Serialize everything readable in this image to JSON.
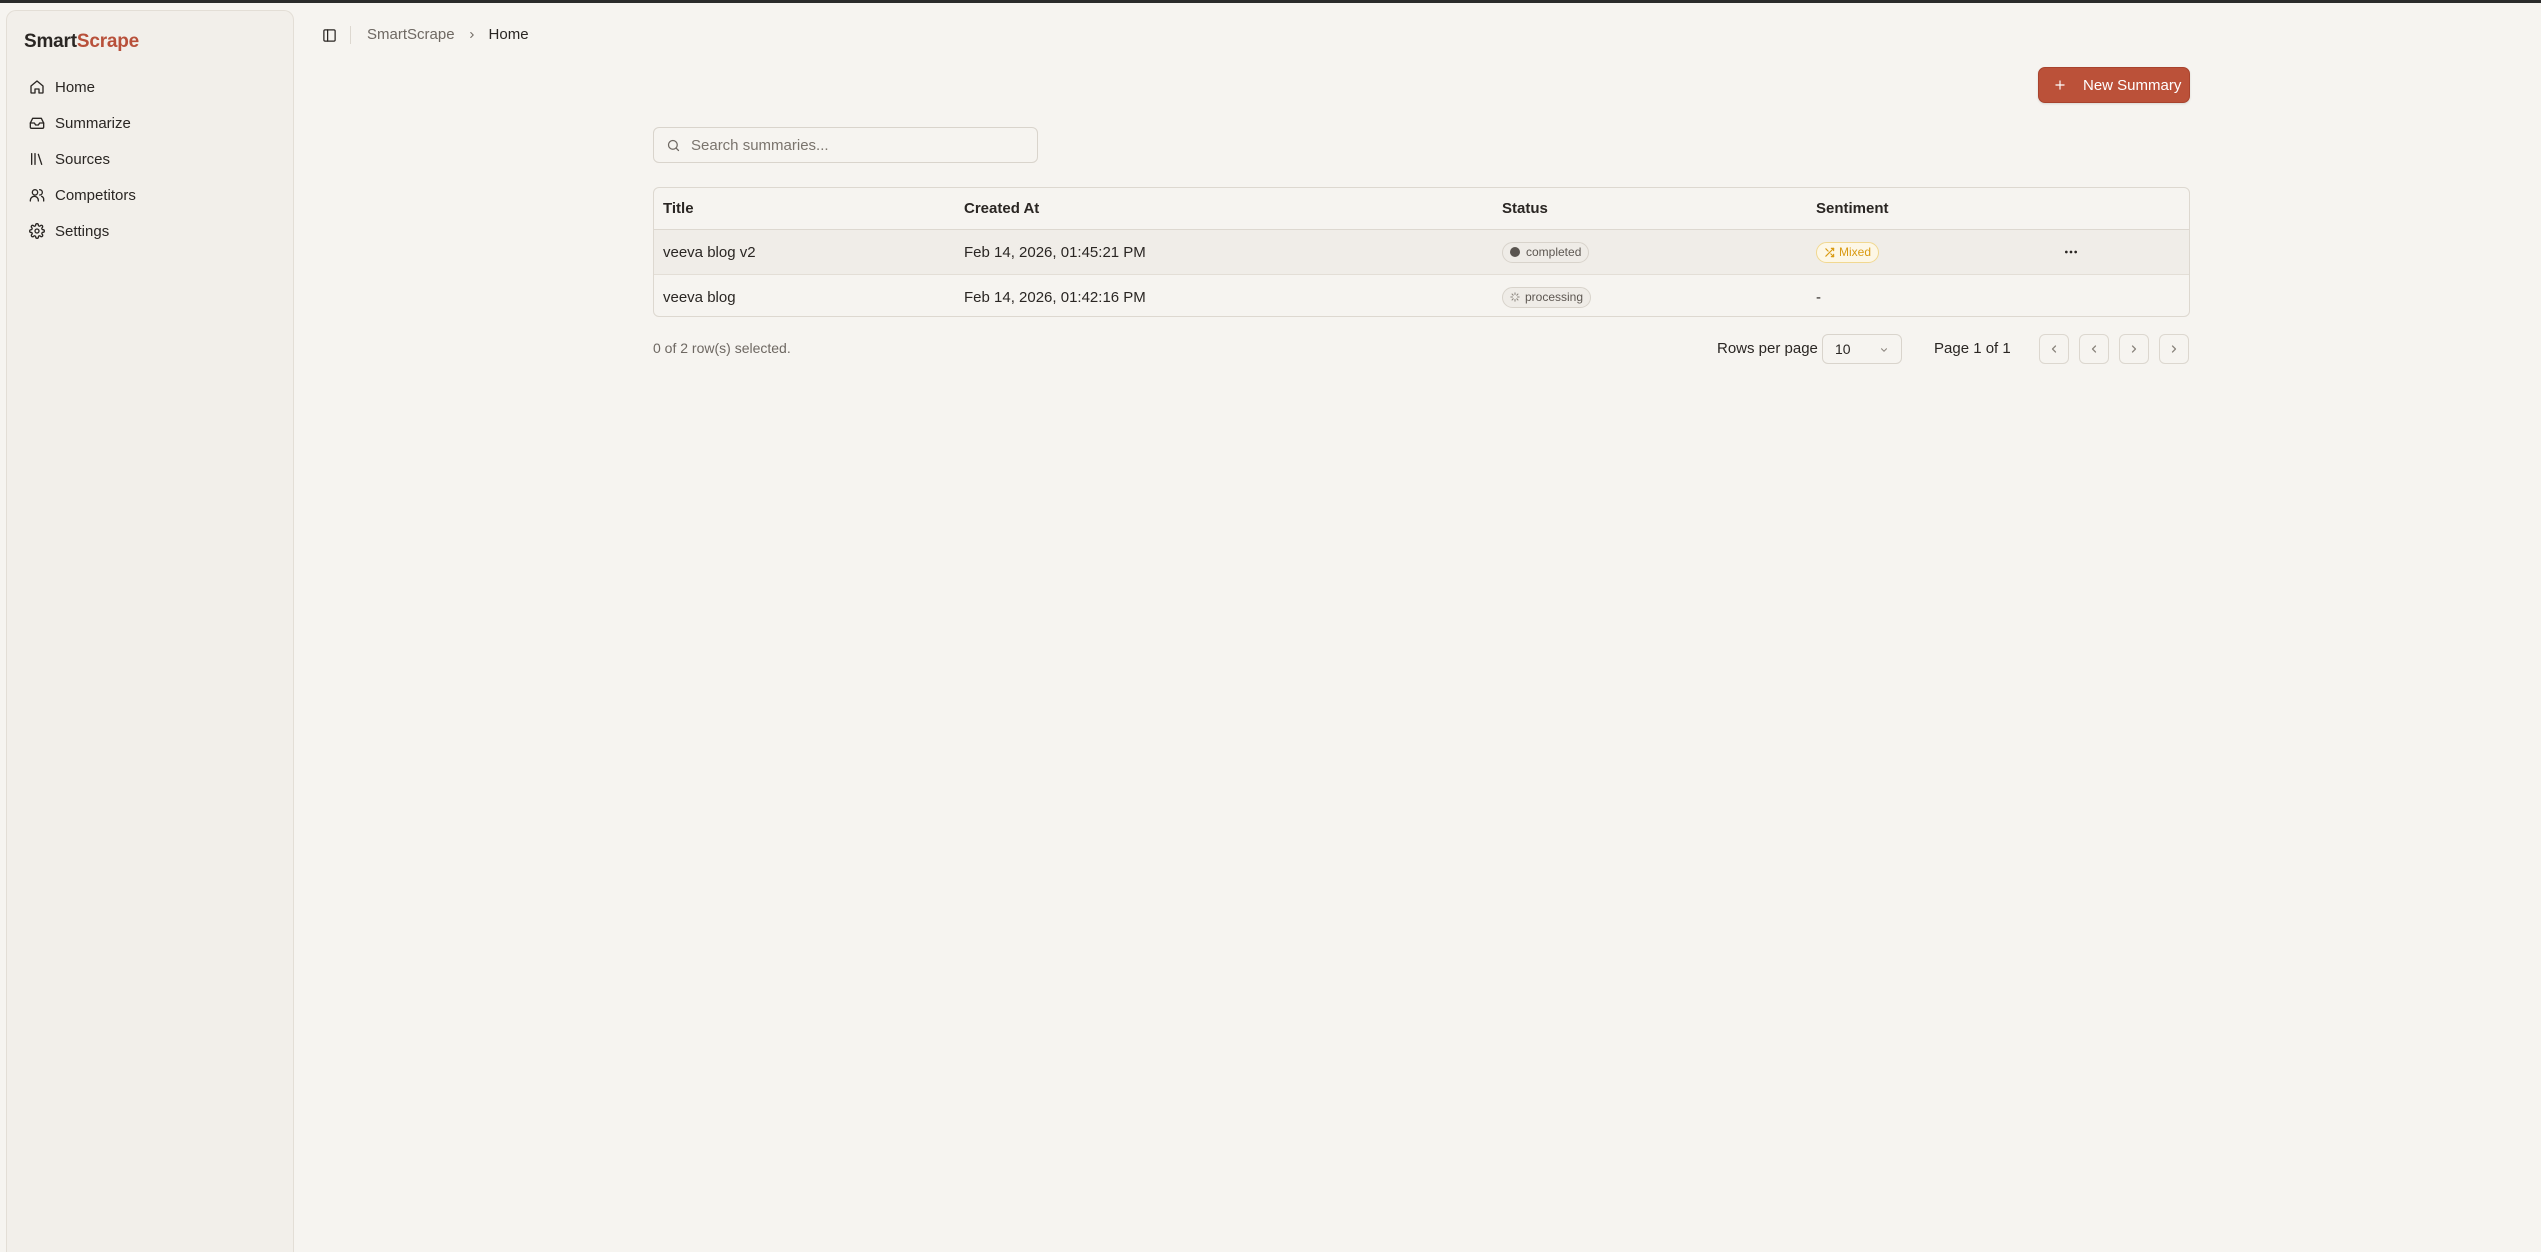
{
  "brand": {
    "part1": "Smart",
    "part2": "Scrape",
    "accent_color": "#b8503a"
  },
  "sidebar": {
    "items": [
      {
        "label": "Home",
        "icon": "home-icon"
      },
      {
        "label": "Summarize",
        "icon": "inbox-icon"
      },
      {
        "label": "Sources",
        "icon": "library-icon"
      },
      {
        "label": "Competitors",
        "icon": "users-icon"
      },
      {
        "label": "Settings",
        "icon": "gear-icon"
      }
    ]
  },
  "header": {
    "breadcrumb": {
      "root": "SmartScrape",
      "current": "Home"
    }
  },
  "toolbar": {
    "new_summary_label": "New Summary"
  },
  "search": {
    "placeholder": "Search summaries..."
  },
  "table": {
    "columns": [
      "Title",
      "Created At",
      "Status",
      "Sentiment"
    ],
    "rows": [
      {
        "title": "veeva blog v2",
        "created_at": "Feb 14, 2026, 01:45:21 PM",
        "status": "completed",
        "sentiment": "Mixed"
      },
      {
        "title": "veeva blog",
        "created_at": "Feb 14, 2026, 01:42:16 PM",
        "status": "processing",
        "sentiment": "-"
      }
    ]
  },
  "footer": {
    "selected_text": "0 of 2 row(s) selected.",
    "rows_per_page_label": "Rows per page",
    "rows_per_page_value": "10",
    "page_text": "Page 1 of 1"
  }
}
